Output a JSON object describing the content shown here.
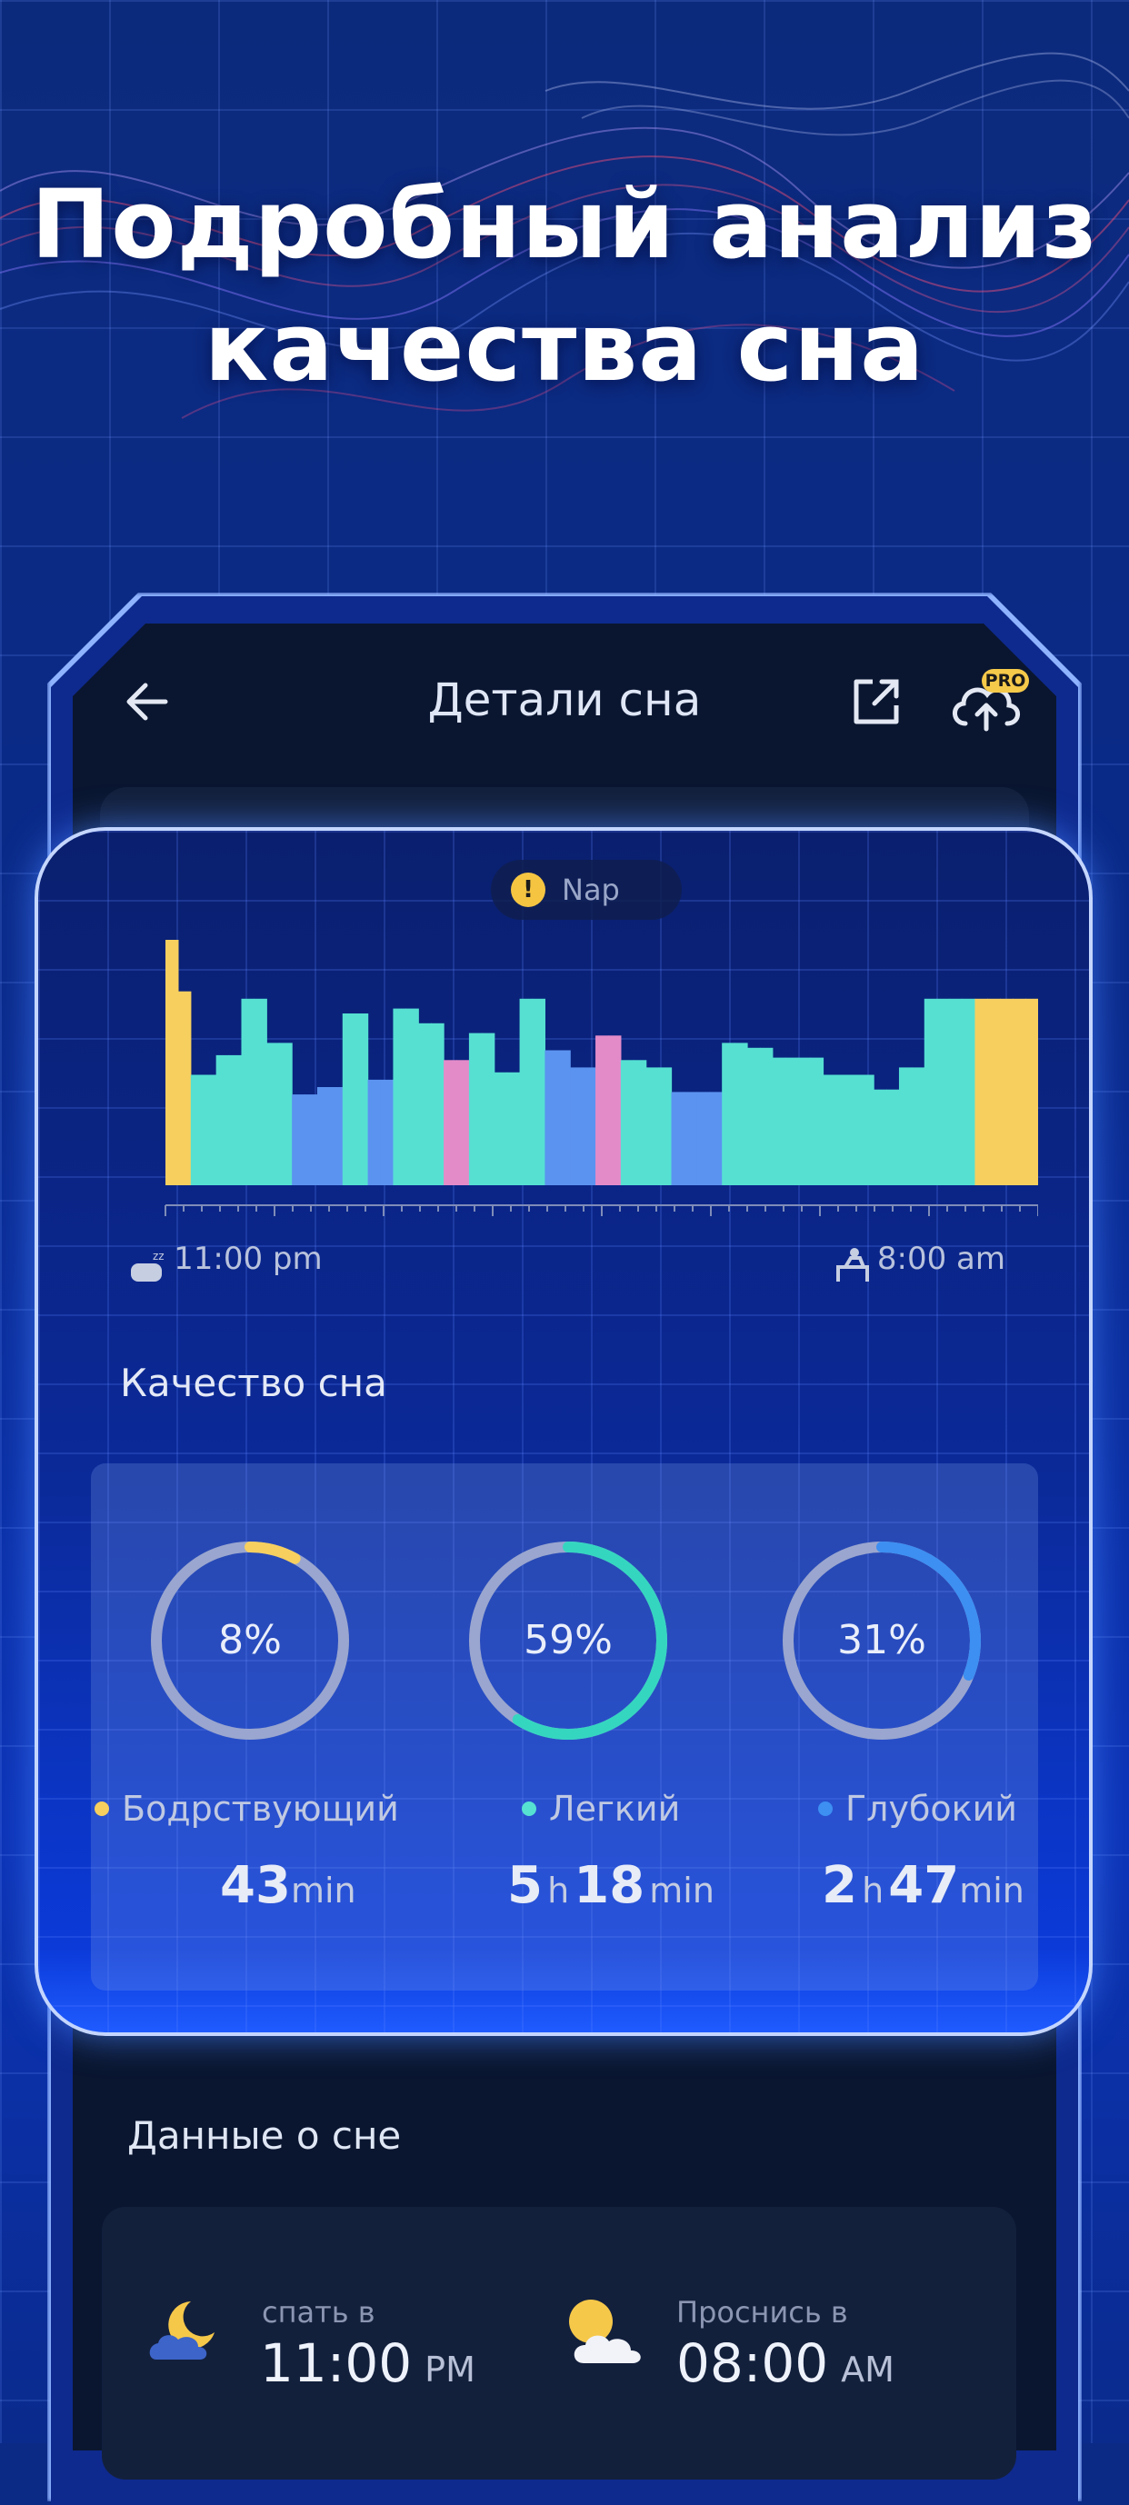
{
  "headline": {
    "line1": "Подробный анализ",
    "line2": "качества сна"
  },
  "header": {
    "title": "Детали сна",
    "pro_badge": "PRO"
  },
  "nap": {
    "label": "Nap"
  },
  "timeline": {
    "start": "11:00 pm",
    "end": "8:00 am"
  },
  "colors": {
    "awake": "#f6cf5f",
    "light": "#56e0d2",
    "deep": "#5b93f0",
    "rem": "#e38bc9"
  },
  "chart_data": {
    "type": "bar",
    "categories": [
      "awake",
      "light",
      "deep",
      "rem"
    ],
    "stages": [
      "awake",
      "awake",
      "light",
      "light",
      "light",
      "light",
      "light",
      "light",
      "light",
      "light",
      "deep",
      "deep",
      "deep",
      "deep",
      "light",
      "light",
      "deep",
      "deep",
      "light",
      "light",
      "light",
      "light",
      "rem",
      "rem",
      "light",
      "light",
      "light",
      "light",
      "light",
      "light",
      "deep",
      "deep",
      "deep",
      "deep",
      "rem",
      "rem",
      "light",
      "light",
      "light",
      "light",
      "deep",
      "deep",
      "deep",
      "deep",
      "light",
      "light",
      "light",
      "light",
      "light",
      "light",
      "light",
      "light",
      "light",
      "light",
      "light",
      "light",
      "light",
      "light",
      "light",
      "light",
      "light",
      "light",
      "light",
      "light",
      "awake",
      "awake",
      "awake",
      "awake",
      "awake"
    ],
    "levels": [
      1.0,
      0.79,
      0.45,
      0.45,
      0.53,
      0.53,
      0.76,
      0.76,
      0.58,
      0.58,
      0.37,
      0.37,
      0.4,
      0.4,
      0.7,
      0.7,
      0.43,
      0.43,
      0.72,
      0.72,
      0.66,
      0.66,
      0.51,
      0.51,
      0.62,
      0.62,
      0.46,
      0.46,
      0.76,
      0.76,
      0.55,
      0.55,
      0.48,
      0.48,
      0.61,
      0.61,
      0.51,
      0.51,
      0.48,
      0.48,
      0.38,
      0.38,
      0.38,
      0.38,
      0.58,
      0.58,
      0.56,
      0.56,
      0.52,
      0.52,
      0.52,
      0.52,
      0.45,
      0.45,
      0.45,
      0.45,
      0.39,
      0.39,
      0.48,
      0.48,
      0.76,
      0.76,
      0.76,
      0.76,
      0.76,
      0.76,
      0.76,
      0.76,
      0.76
    ]
  },
  "quality": {
    "title": "Качество сна",
    "items": [
      {
        "percent": "8%",
        "fraction": 0.08,
        "label": "Бодрствующий",
        "color": "#f6cf5f",
        "hours": "",
        "h_unit": "",
        "minutes": "43",
        "m_unit": "min"
      },
      {
        "percent": "59%",
        "fraction": 0.59,
        "label": "Легкий",
        "color": "#35d6c0",
        "hours": "5",
        "h_unit": "h",
        "minutes": "18",
        "m_unit": "min"
      },
      {
        "percent": "31%",
        "fraction": 0.31,
        "label": "Глубокий",
        "color": "#3d8ff2",
        "hours": "2",
        "h_unit": "h",
        "minutes": "47",
        "m_unit": "min"
      }
    ]
  },
  "sleep_data": {
    "title": "Данные о сне",
    "bed_label": "спать в",
    "bed_time": "11:00",
    "bed_ampm": "PM",
    "wake_label": "Проснись в",
    "wake_time": "08:00",
    "wake_ampm": "AM"
  }
}
